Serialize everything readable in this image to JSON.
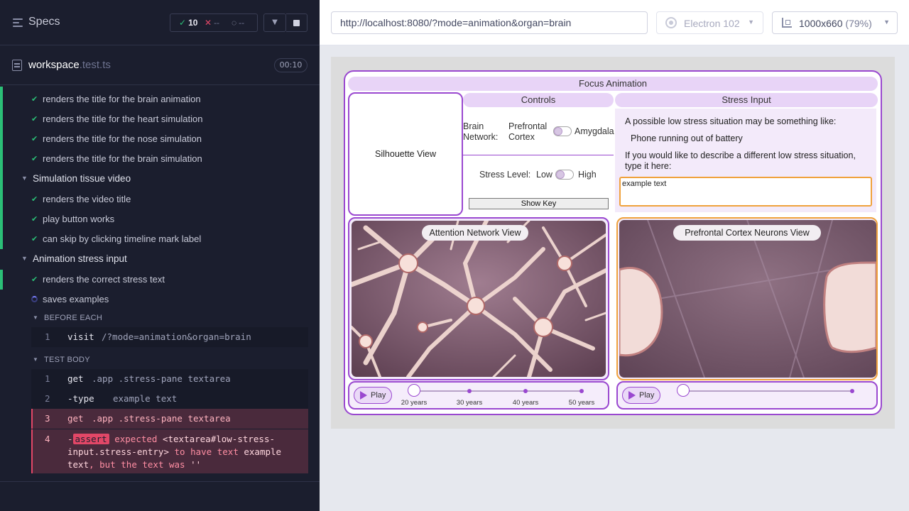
{
  "reporter": {
    "title": "Specs",
    "stats": {
      "passed": "10",
      "failed": "--",
      "pending": "--"
    },
    "spec": {
      "name": "workspace",
      "ext": ".test.ts",
      "duration": "00:10"
    },
    "tests": [
      "renders the title for the brain animation",
      "renders the title for the heart simulation",
      "renders the title for the nose simulation",
      "renders the title for the brain simulation"
    ],
    "suite1": {
      "title": "Simulation tissue video",
      "tests": [
        "renders the video title",
        "play button works",
        "can skip by clicking timeline mark label"
      ]
    },
    "suite2": {
      "title": "Animation stress input",
      "tests": [
        "renders the correct stress text",
        "saves examples"
      ]
    },
    "before_each": {
      "title": "BEFORE EACH",
      "cmd": {
        "num": "1",
        "name": "visit",
        "arg": "/?mode=animation&organ=brain"
      }
    },
    "test_body": {
      "title": "TEST BODY",
      "cmds": [
        {
          "num": "1",
          "name": "get",
          "arg": ".app .stress-pane textarea"
        },
        {
          "num": "2",
          "name": "-type",
          "arg": "example text"
        },
        {
          "num": "3",
          "name": "get",
          "arg": ".app .stress-pane textarea"
        }
      ],
      "assert": {
        "num": "4",
        "prefix": "-",
        "badge": "assert",
        "p1": "expected",
        "p2": "<textarea#low-stress-input.stress-entry>",
        "p3": "to have text",
        "p4": "example text",
        "p5": ", but the text was",
        "p6": "''"
      }
    }
  },
  "aut": {
    "url": "http://localhost:8080/?mode=animation&organ=brain",
    "browser": "Electron 102",
    "viewport": "1000x660",
    "zoom": "(79%)"
  },
  "app": {
    "title": "Focus Animation",
    "controls_title": "Controls",
    "stress_title": "Stress Input",
    "silhouette": "Silhouette View",
    "controls": {
      "brain_network": "Brain Network:",
      "prefrontal": "Prefrontal Cortex",
      "amygdala": "Amygdala",
      "stress_level": "Stress Level:",
      "low": "Low",
      "high": "High",
      "show_key": "Show Key"
    },
    "stress": {
      "intro": "A possible low stress situation may be something like:",
      "example": "Phone running out of battery",
      "prompt": "If you would like to describe a different low stress situation, type it here:",
      "textarea_value": "example text"
    },
    "left_video": "Attention Network View",
    "right_video": "Prefrontal Cortex Neurons View",
    "play": "Play",
    "timeline": [
      "20 years",
      "30 years",
      "40 years",
      "50 years"
    ]
  },
  "colors": {
    "accent": "#9a48d0",
    "pass": "#2bbf77",
    "fail": "#e24767",
    "reporter_bg": "#1b1e2e"
  }
}
